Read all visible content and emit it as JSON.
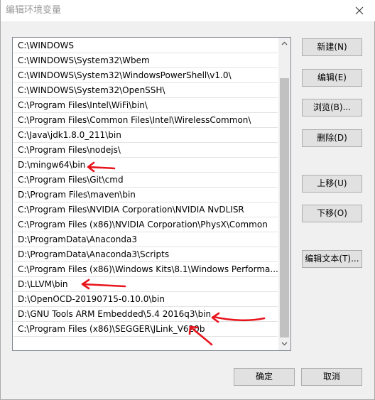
{
  "window": {
    "title": "编辑环境变量",
    "close_glyph": "close-icon"
  },
  "path_list": {
    "items": [
      "C:\\WINDOWS",
      "C:\\WINDOWS\\System32\\Wbem",
      "C:\\WINDOWS\\System32\\WindowsPowerShell\\v1.0\\",
      "C:\\WINDOWS\\System32\\OpenSSH\\",
      "C:\\Program Files\\Intel\\WiFi\\bin\\",
      "C:\\Program Files\\Common Files\\Intel\\WirelessCommon\\",
      "C:\\Java\\jdk1.8.0_211\\bin",
      "C:\\Program Files\\nodejs\\",
      "D:\\mingw64\\bin",
      "C:\\Program Files\\Git\\cmd",
      "D:\\Program Files\\maven\\bin",
      "C:\\Program Files\\NVIDIA Corporation\\NVIDIA NvDLISR",
      "C:\\Program Files (x86)\\NVIDIA Corporation\\PhysX\\Common",
      "D:\\ProgramData\\Anaconda3",
      "D:\\ProgramData\\Anaconda3\\Scripts",
      "C:\\Program Files (x86)\\Windows Kits\\8.1\\Windows Performa...",
      "D:\\LLVM\\bin",
      "D:\\OpenOCD-20190715-0.10.0\\bin",
      "D:\\GNU Tools ARM Embedded\\5.4 2016q3\\bin",
      "C:\\Program Files (x86)\\SEGGER\\JLink_V620b"
    ]
  },
  "buttons": {
    "new": "新建(N)",
    "edit": "编辑(E)",
    "browse": "浏览(B)...",
    "delete": "删除(D)",
    "move_up": "上移(U)",
    "move_down": "下移(O)",
    "edit_text": "编辑文本(T)...",
    "ok": "确定",
    "cancel": "取消"
  },
  "annotation_color": "#e8141c"
}
